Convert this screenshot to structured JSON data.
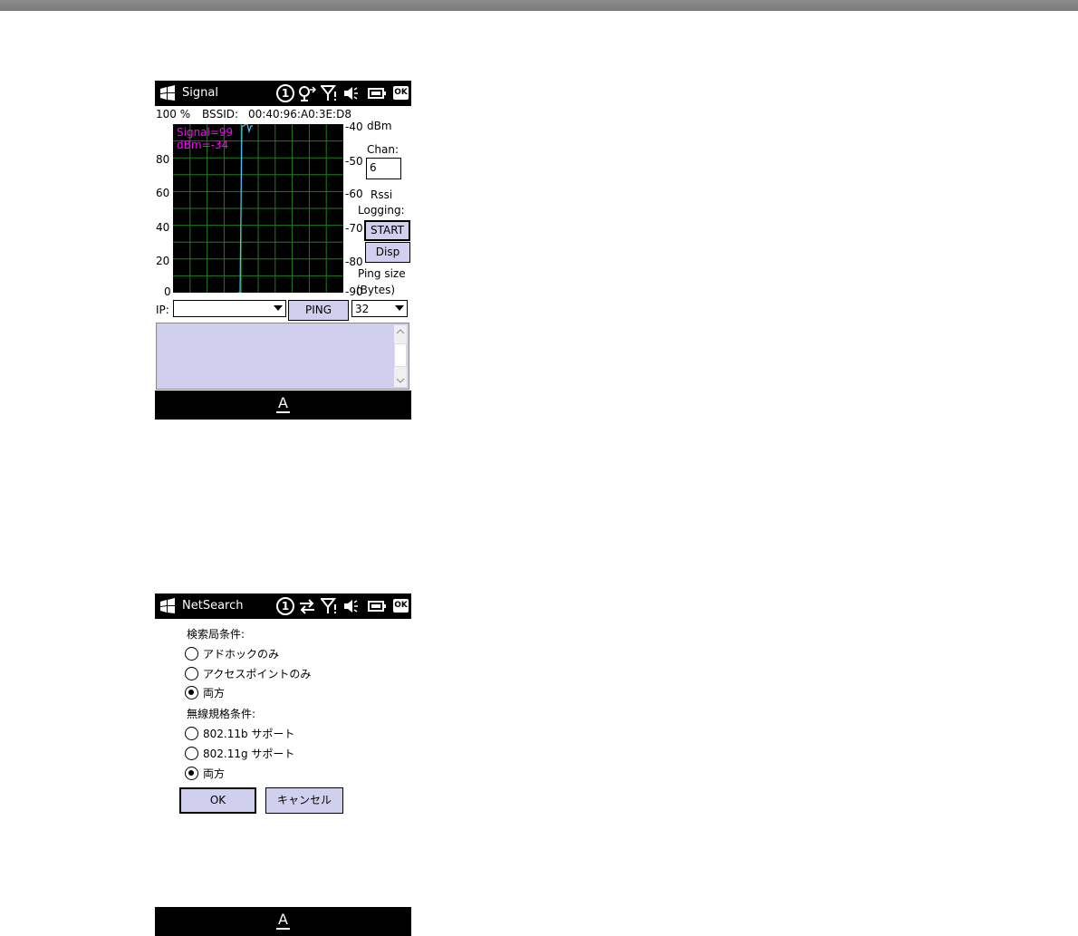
{
  "signal_screen": {
    "title": "Signal",
    "status_number": "1",
    "ok_label": "OK",
    "percent": "100 %",
    "bssid_label": "BSSID:",
    "bssid": "00:40:96:A0:3E:D8",
    "overlay_signal": "Signal=99",
    "overlay_dbm": "dBm=-34",
    "left_axis": [
      "80",
      "60",
      "40",
      "20",
      "0"
    ],
    "right_axis": [
      "-40",
      "-50",
      "-60",
      "-70",
      "-80",
      "-90"
    ],
    "dbm_label": "dBm",
    "chan_label": "Chan:",
    "chan_value": "6",
    "rssi_label": "Rssi",
    "logging_label": "Logging:",
    "start_button": "START",
    "disp_button": "Disp",
    "ping_size_label": "Ping size",
    "bytes_label": "(Bytes)",
    "ip_label": "IP:",
    "ip_value": "",
    "ping_button": "PING",
    "ping_size_value": "32",
    "keyboard_icon": "A",
    "colors": {
      "overlay": "#ff00ff",
      "grid": "#1e7d1e",
      "trace": "#4fc3f7",
      "button": "#d0d0ee"
    }
  },
  "netsearch_screen": {
    "title": "NetSearch",
    "status_number": "1",
    "ok_label": "OK",
    "station_group": "検索局条件:",
    "station_options": [
      "アドホックのみ",
      "アクセスポイントのみ",
      "両方"
    ],
    "station_selected": 2,
    "wireless_group": "無線規格条件:",
    "wireless_options": [
      "802.11b サポート",
      "802.11g サポート",
      "両方"
    ],
    "wireless_selected": 2,
    "ok_button": "OK",
    "cancel_button": "キャンセル",
    "keyboard_icon": "A"
  }
}
